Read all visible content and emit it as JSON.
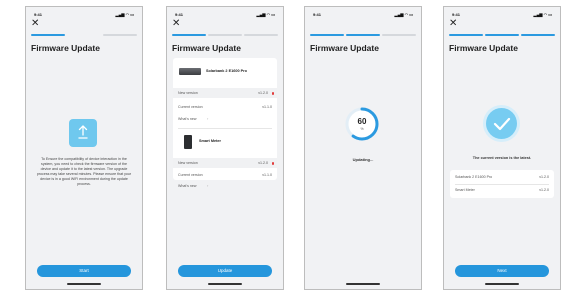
{
  "status": {
    "time": "9:41",
    "icons": "signal wifi battery"
  },
  "accent": "#2596dc",
  "screens": [
    {
      "close_icon": "✕",
      "title": "Firmware Update",
      "progress": {
        "active": 1,
        "total": 3
      },
      "icon": "upload-icon",
      "description": "To Ensure the compatibility of device interaction in the system, you need to check the firmware version of the device and update it to the latest version. The upgrade process may take several minutes. Please ensure that your device is in a good WiFi environment during the update process.",
      "button": "Start"
    },
    {
      "close_icon": "✕",
      "title": "Firmware Update",
      "progress": {
        "active": 1,
        "total": 3
      },
      "devices": [
        {
          "name": "Solarbank 2 E1600 Pro",
          "new_version_label": "New version",
          "new_version": "v1.2.0",
          "current_version_label": "Current version",
          "current_version": "v1.1.0",
          "whats_new": "What's new"
        },
        {
          "name": "Smart Meter",
          "new_version_label": "New version",
          "new_version": "v1.2.0",
          "current_version_label": "Current version",
          "current_version": "v1.1.0",
          "whats_new": "What's new"
        }
      ],
      "button": "Update"
    },
    {
      "title": "Firmware Update",
      "progress": {
        "active": 2,
        "total": 3
      },
      "percent_value": 60,
      "percent_number": "60",
      "percent_sign": "%",
      "status": "Updating..."
    },
    {
      "close_icon": "✕",
      "title": "Firmware Update",
      "progress": {
        "active": 3,
        "total": 3
      },
      "icon": "check-icon",
      "message": "The current version is the latest.",
      "devices": [
        {
          "name": "Solarbank 2 E1600 Pro",
          "version": "v1.2.0"
        },
        {
          "name": "Smart Meter",
          "version": "v1.2.0"
        }
      ],
      "button": "Next"
    }
  ]
}
